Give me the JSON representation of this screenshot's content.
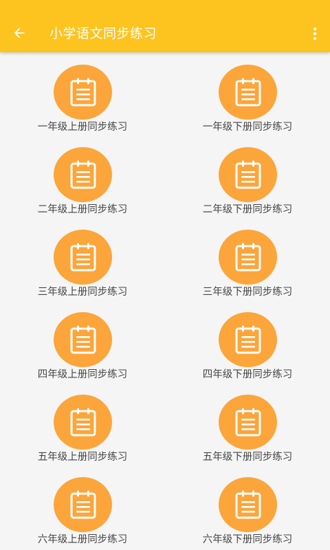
{
  "appbar": {
    "title": "小学语文同步练习",
    "back_icon": "arrow-left-icon",
    "menu_icon": "more-vert-icon",
    "color": "#fdc41f"
  },
  "accent_color": "#fca53b",
  "grades": [
    {
      "upper": "一年级上册同步练习",
      "lower": "一年级下册同步练习"
    },
    {
      "upper": "二年级上册同步练习",
      "lower": "二年级下册同步练习"
    },
    {
      "upper": "三年级上册同步练习",
      "lower": "三年级下册同步练习"
    },
    {
      "upper": "四年级上册同步练习",
      "lower": "四年级下册同步练习"
    },
    {
      "upper": "五年级上册同步练习",
      "lower": "五年级下册同步练习"
    },
    {
      "upper": "六年级上册同步练习",
      "lower": "六年级下册同步练习"
    }
  ],
  "item_icon": "notepad-icon"
}
